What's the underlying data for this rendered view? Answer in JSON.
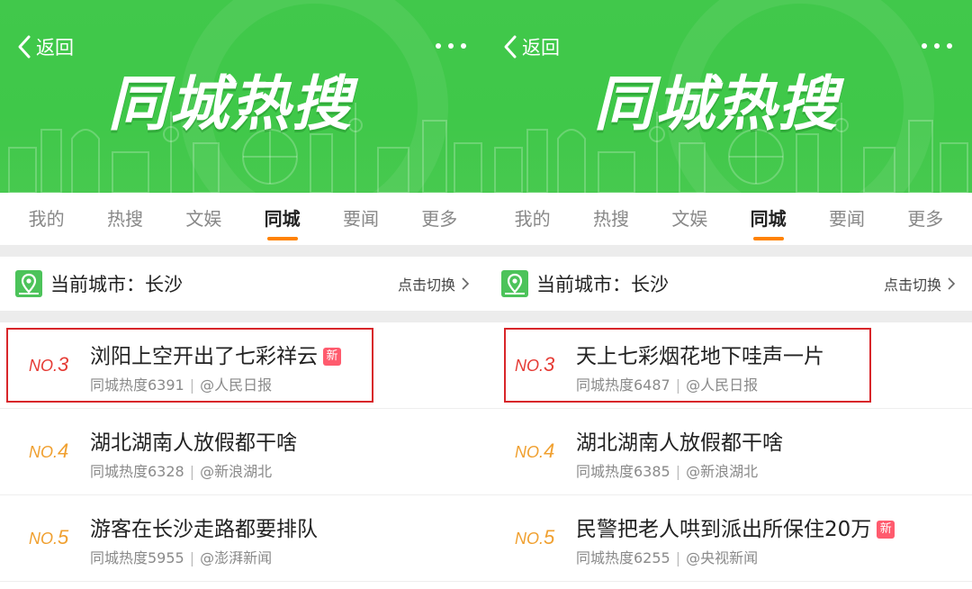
{
  "colors": {
    "banner_green": "#41c84b",
    "tab_active_underline": "#ff8200",
    "rank_red": "#e53b35",
    "rank_orange": "#f0a030",
    "badge_pink": "#ff5b6e",
    "highlight_red": "#d8262a"
  },
  "panels": [
    {
      "header": {
        "back_label": "返回",
        "banner_title": "同城热搜"
      },
      "tabs": [
        {
          "label": "我的",
          "active": false
        },
        {
          "label": "热搜",
          "active": false
        },
        {
          "label": "文娱",
          "active": false
        },
        {
          "label": "同城",
          "active": true
        },
        {
          "label": "要闻",
          "active": false
        },
        {
          "label": "更多",
          "active": false
        }
      ],
      "city": {
        "label": "当前城市：长沙",
        "switch_label": "点击切换"
      },
      "items": [
        {
          "rank_prefix": "NO.",
          "rank_num": "3",
          "title": "浏阳上空开出了七彩祥云",
          "badge": "新",
          "heat": "同城热度6391",
          "source": "@人民日报",
          "highlighted": true
        },
        {
          "rank_prefix": "NO.",
          "rank_num": "4",
          "title": "湖北湖南人放假都干啥",
          "badge": "",
          "heat": "同城热度6328",
          "source": "@新浪湖北",
          "highlighted": false
        },
        {
          "rank_prefix": "NO.",
          "rank_num": "5",
          "title": "游客在长沙走路都要排队",
          "badge": "",
          "heat": "同城热度5955",
          "source": "@澎湃新闻",
          "highlighted": false
        }
      ]
    },
    {
      "header": {
        "back_label": "返回",
        "banner_title": "同城热搜"
      },
      "tabs": [
        {
          "label": "我的",
          "active": false
        },
        {
          "label": "热搜",
          "active": false
        },
        {
          "label": "文娱",
          "active": false
        },
        {
          "label": "同城",
          "active": true
        },
        {
          "label": "要闻",
          "active": false
        },
        {
          "label": "更多",
          "active": false
        }
      ],
      "city": {
        "label": "当前城市：长沙",
        "switch_label": "点击切换"
      },
      "items": [
        {
          "rank_prefix": "NO.",
          "rank_num": "3",
          "title": "天上七彩烟花地下哇声一片",
          "badge": "",
          "heat": "同城热度6487",
          "source": "@人民日报",
          "highlighted": true
        },
        {
          "rank_prefix": "NO.",
          "rank_num": "4",
          "title": "湖北湖南人放假都干啥",
          "badge": "",
          "heat": "同城热度6385",
          "source": "@新浪湖北",
          "highlighted": false
        },
        {
          "rank_prefix": "NO.",
          "rank_num": "5",
          "title": "民警把老人哄到派出所保住20万",
          "badge": "新",
          "heat": "同城热度6255",
          "source": "@央视新闻",
          "highlighted": false
        }
      ]
    }
  ]
}
